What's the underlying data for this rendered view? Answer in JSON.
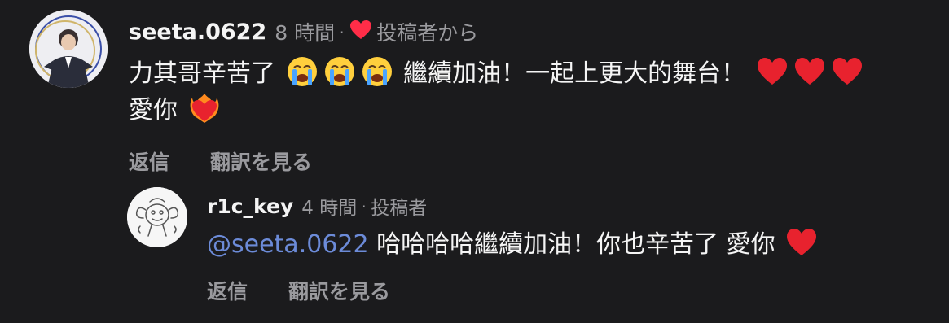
{
  "comment": {
    "username": "seeta.0622",
    "time": "8 時間",
    "separator": "·",
    "liked_by_author": "投稿者から",
    "text_part1": "力其哥辛苦了",
    "text_part2": "繼續加油！一起上更大的舞台！",
    "text_line2": "愛你",
    "reply_label": "返信",
    "translate_label": "翻訳を見る",
    "emojis": [
      "loudly-crying-face-icon",
      "heart-icon",
      "heart-on-fire-icon"
    ],
    "colors": {
      "heart": "#ff2d48"
    }
  },
  "reply": {
    "username": "r1c_key",
    "time": "4 時間",
    "separator": "·",
    "author_badge": "投稿者",
    "mention": "@seeta.0622",
    "text": "哈哈哈哈繼續加油！你也辛苦了 愛你",
    "reply_label": "返信",
    "translate_label": "翻訳を見る",
    "colors": {
      "mention": "#6c8bd8"
    }
  }
}
